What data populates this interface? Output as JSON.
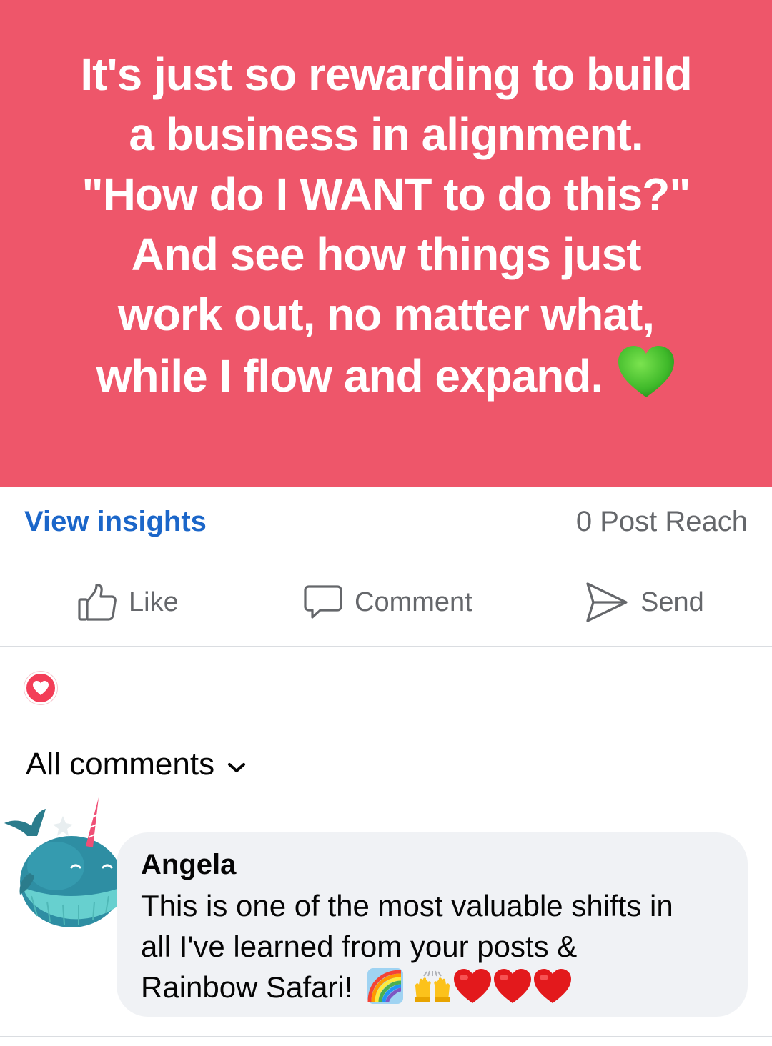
{
  "post": {
    "lines": [
      "It's just so rewarding to build",
      "a business in alignment.",
      "\"How do I WANT to do this?\"",
      "And see how things just",
      "work out, no matter what,",
      "while I flow and expand."
    ],
    "background_color": "#ee566a",
    "emoji": "green-heart-icon"
  },
  "insights": {
    "view_insights_label": "View insights",
    "post_reach": "0 Post Reach"
  },
  "actions": {
    "like_label": "Like",
    "comment_label": "Comment",
    "send_label": "Send"
  },
  "reactions": {
    "icon": "love-reaction-icon"
  },
  "comments_filter": {
    "label": "All comments"
  },
  "comment": {
    "author": "Angela",
    "text_lines": [
      "This is one of the most valuable shifts in",
      "all I've learned from your posts &",
      "Rainbow Safari!"
    ],
    "emojis": [
      "rainbow-icon",
      "raising-hands-icon",
      "red-heart-icon",
      "red-heart-icon",
      "red-heart-icon"
    ]
  },
  "colors": {
    "link_blue": "#1b66c9",
    "muted_gray": "#65676b",
    "bubble_bg": "#f0f2f5",
    "love_red": "#f33e58"
  }
}
